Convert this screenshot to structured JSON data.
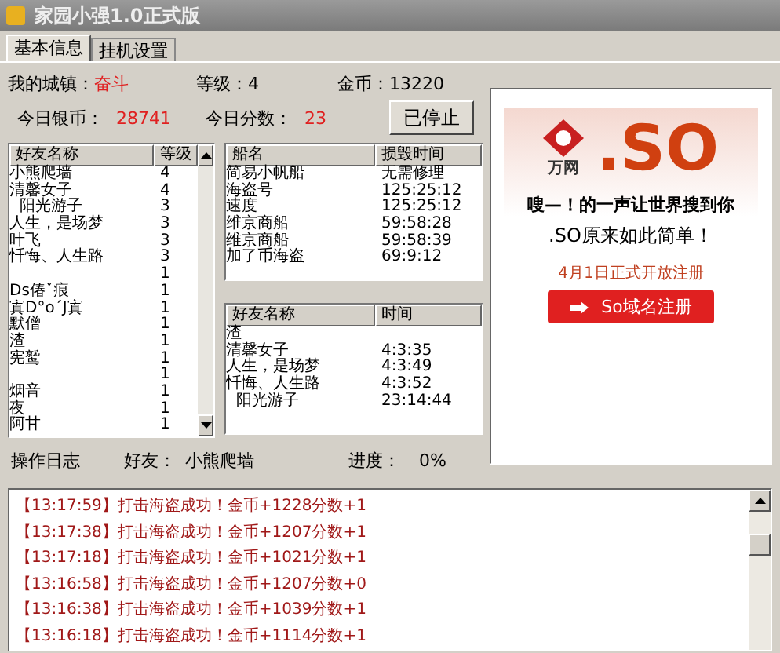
{
  "window": {
    "title": "家园小强1.0正式版"
  },
  "tabs": [
    {
      "label": "基本信息",
      "selected": true
    },
    {
      "label": "挂机设置",
      "selected": false
    }
  ],
  "stats": [
    {
      "label": "我的城镇：",
      "value": "奋斗"
    },
    {
      "label": "等级：",
      "value": "4"
    },
    {
      "label": "金币：",
      "value": "13220"
    }
  ],
  "stats2": [
    {
      "label": "今日银币：",
      "value": "28741"
    },
    {
      "label": "今日分数：",
      "value": "23"
    }
  ],
  "stop_button": "已停止",
  "friends_table": {
    "columns": [
      "好友名称",
      "等级"
    ],
    "rows": [
      [
        "小熊爬墙",
        "4"
      ],
      [
        "清馨女子",
        "4"
      ],
      [
        "  阳光游子",
        "3"
      ],
      [
        "人生，是场梦",
        "3"
      ],
      [
        "叶飞",
        "3"
      ],
      [
        "忏悔、人生路",
        "3"
      ],
      [
        "",
        "1"
      ],
      [
        "Ds偆ˇ痕",
        "1"
      ],
      [
        "寘D°o´J寘",
        "1"
      ],
      [
        "默僧",
        "1"
      ],
      [
        "渣",
        "1"
      ],
      [
        "宪鹫",
        "1"
      ],
      [
        "",
        "1"
      ],
      [
        "烟音",
        "1"
      ],
      [
        "夜",
        "1"
      ],
      [
        "阿甘",
        "1"
      ]
    ]
  },
  "ships_table": {
    "columns": [
      "船名",
      "损毁时间"
    ],
    "rows": [
      [
        "简易小帆船",
        "无需修理"
      ],
      [
        "海盗号",
        "125:25:12"
      ],
      [
        "速度",
        "125:25:12"
      ],
      [
        "维京商船",
        "59:58:28"
      ],
      [
        "维京商船",
        "59:58:39"
      ],
      [
        "加了币海盗",
        "69:9:12"
      ]
    ]
  },
  "attack_table": {
    "columns": [
      "好友名称",
      "时间"
    ],
    "rows": [
      [
        "渣",
        ""
      ],
      [
        "清馨女子",
        "4:3:35"
      ],
      [
        "人生，是场梦",
        "4:3:49"
      ],
      [
        "忏悔、人生路",
        "4:3:52"
      ],
      [
        "  阳光游子",
        "23:14:44"
      ]
    ]
  },
  "ad": {
    "brand": "万网",
    "headline": ".SO",
    "slogan": "嗖—！的一声让世界搜到你",
    "tagline": ".SO原来如此简单！",
    "date": "4月1日正式开放注册",
    "button": "So域名注册"
  },
  "status": {
    "log_label": "操作日志",
    "friend_label": "好友：",
    "friend": "小熊爬墙",
    "progress_label": "进度：",
    "progress": "0%"
  },
  "log": [
    "【13:17:59】打击海盗成功！金币+1228分数+1",
    "【13:17:38】打击海盗成功！金币+1207分数+1",
    "【13:17:18】打击海盗成功！金币+1021分数+1",
    "【13:16:58】打击海盗成功！金币+1207分数+0",
    "【13:16:38】打击海盗成功！金币+1039分数+1",
    "【13:16:18】打击海盗成功！金币+1114分数+1"
  ]
}
